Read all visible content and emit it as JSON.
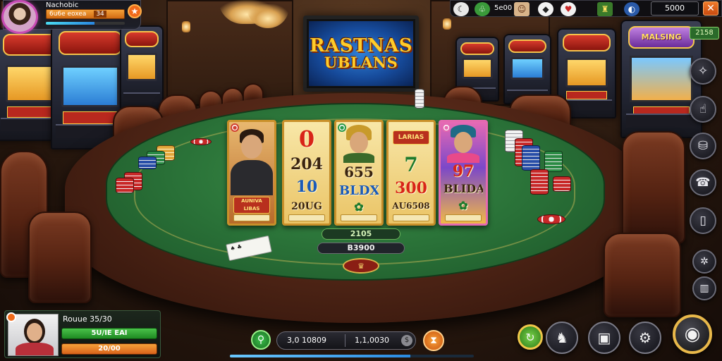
{
  "tv": {
    "line1": "RASTNAS",
    "line2": "UBLANS"
  },
  "slots": {
    "left_a_top": "",
    "left_a_label": "",
    "left_b_top": "",
    "featured_title": "MALSING",
    "featured_plate": "",
    "right_badge": "2158"
  },
  "hud_player": {
    "name": "Nachobic",
    "balance": "6u6e eoxea",
    "balance_suffix": "34",
    "xp_fraction": 0.62,
    "star_icon": "star-icon"
  },
  "hud_top": {
    "stat_1": "5e00",
    "coins": "5000"
  },
  "reels": [
    {
      "lines": [],
      "plate": "AUNIVA LIBAS",
      "footer": ""
    },
    {
      "lines": [
        "0",
        "204",
        "10",
        "20UG"
      ],
      "footer": ""
    },
    {
      "lines": [
        "655",
        "BLDX"
      ],
      "footer": ""
    },
    {
      "lines": [
        "7",
        "300",
        "AU6508"
      ],
      "plate": "LARIAS",
      "footer": ""
    },
    {
      "lines": [
        "97",
        "BLIDA"
      ],
      "footer": ""
    }
  ],
  "table": {
    "pot_top": "2105",
    "pot_bottom": "B3900"
  },
  "bottom_player": {
    "name": "Rouue 35/30",
    "stat_green": "5U/IE EAI",
    "stat_orange": "20/00"
  },
  "bet_bar": {
    "left_value": "3,0 10809",
    "right_value": "1,1,0030"
  },
  "progress": {
    "fraction": 0.74
  },
  "colors": {
    "felt": "#2a7238",
    "rail": "#4a2214",
    "accent_orange": "#f06a1a",
    "accent_gold": "#e8b84a",
    "hud_dark": "#14141a"
  },
  "icons": {
    "side": [
      "compass-icon",
      "hand-icon",
      "coin-shield-icon",
      "phone-icon",
      "door-icon",
      "gear-settings-icon",
      "chart-icon"
    ],
    "bottom_right": [
      "auto-spin-icon",
      "horse-icon",
      "backpack-icon",
      "settings-icon",
      "spin-icon"
    ]
  }
}
